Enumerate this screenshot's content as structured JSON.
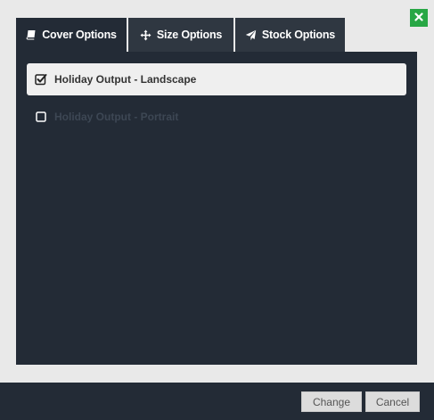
{
  "tabs": [
    {
      "label": "Cover Options",
      "icon": "book-icon",
      "active": true
    },
    {
      "label": "Size Options",
      "icon": "move-icon",
      "active": false
    },
    {
      "label": "Stock Options",
      "icon": "paper-plane-icon",
      "active": false
    }
  ],
  "options": [
    {
      "label": "Holiday Output - Landscape",
      "checked": true
    },
    {
      "label": "Holiday Output - Portrait",
      "checked": false
    }
  ],
  "footer": {
    "change_label": "Change",
    "cancel_label": "Cancel"
  },
  "colors": {
    "close_button": "#28a745",
    "panel_background": "#232b36",
    "page_background": "#e9e9e9"
  },
  "close_icon": "close-icon"
}
